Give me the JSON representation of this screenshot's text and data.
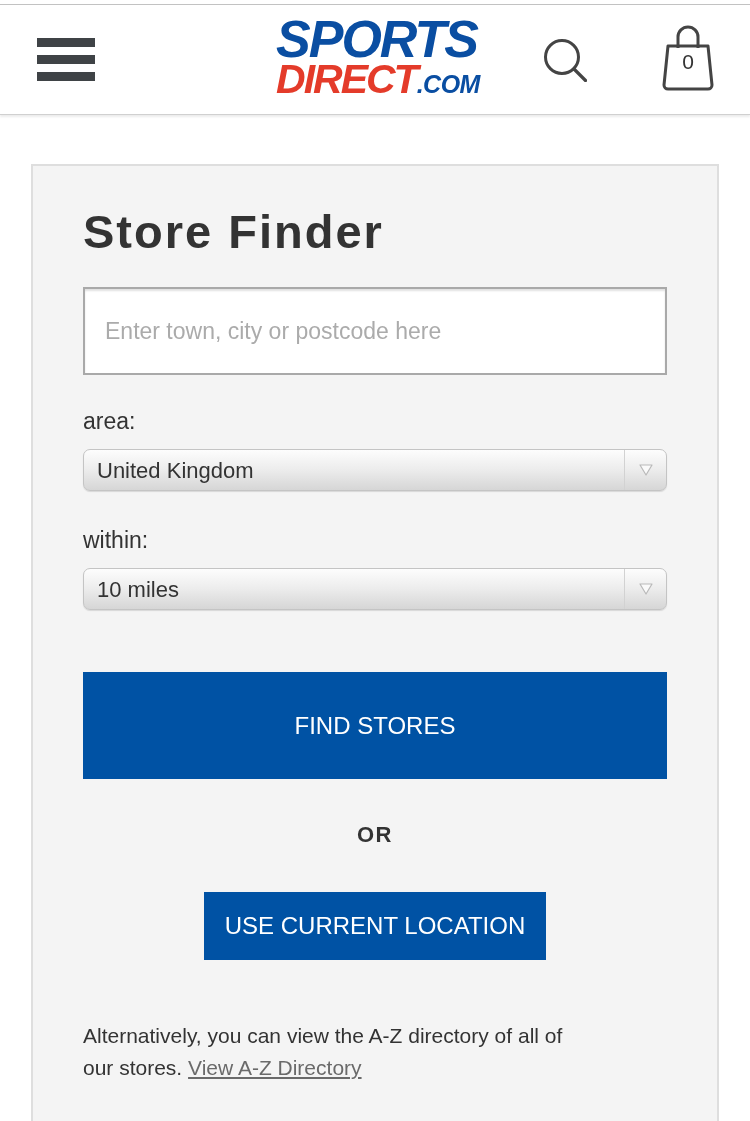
{
  "header": {
    "logo": {
      "line_1": "SPORTS",
      "line_2": "DIRECT",
      "suffix": ".COM"
    },
    "cart": {
      "count": "0"
    }
  },
  "store_finder": {
    "title": "Store Finder",
    "search": {
      "placeholder": "Enter town, city or postcode here"
    },
    "fields": [
      {
        "label": "area:",
        "value": "United Kingdom"
      },
      {
        "label": "within:",
        "value": "10 miles"
      }
    ],
    "find_button": "FIND STORES",
    "separator": "OR",
    "location_button": "USE CURRENT LOCATION",
    "note": {
      "text": "Alternatively, you can view the A-Z directory of all of our stores.",
      "link": "View A-Z Directory"
    }
  }
}
